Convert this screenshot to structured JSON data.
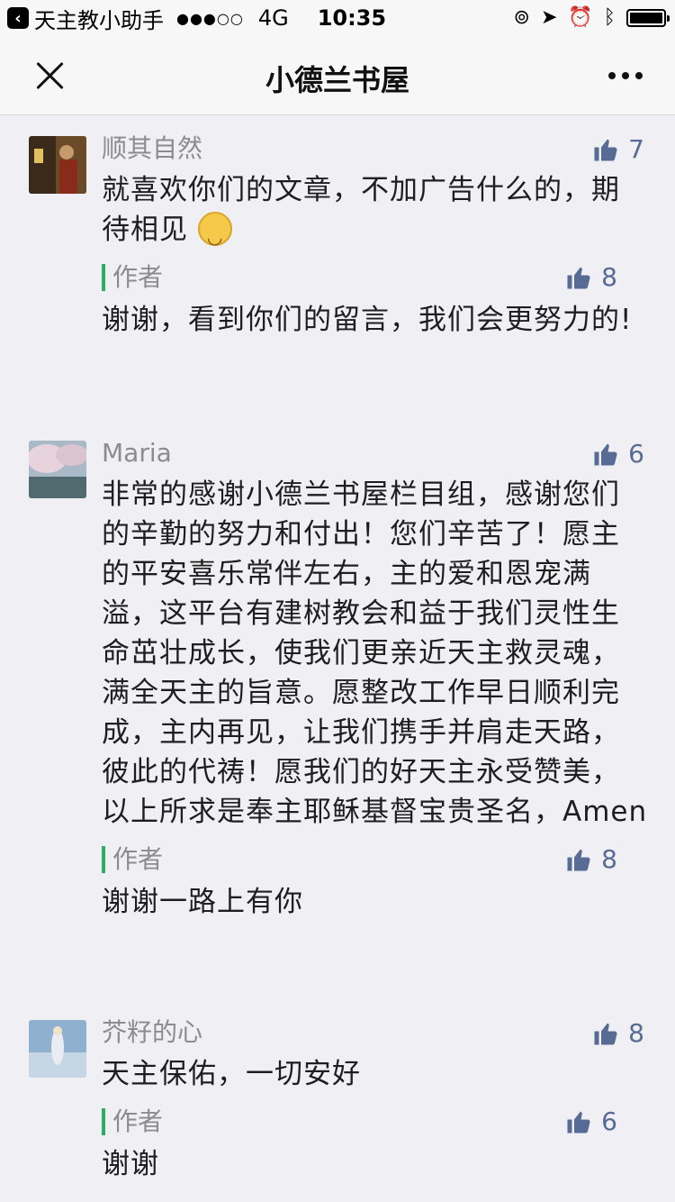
{
  "status": {
    "back_app": "天主教小助手",
    "signal": "●●●○○",
    "network": "4G",
    "time": "10:35"
  },
  "nav": {
    "title": "小德兰书屋"
  },
  "comments": [
    {
      "user": "顺其自然",
      "likes": "7",
      "text": "就喜欢你们的文章，不加广告什么的，期待相见",
      "reply": {
        "label": "作者",
        "likes": "8",
        "text": "谢谢，看到你们的留言，我们会更努力的!"
      }
    },
    {
      "user": "Maria",
      "likes": "6",
      "text": "非常的感谢小德兰书屋栏目组，感谢您们的辛勤的努力和付出！您们辛苦了！愿主的平安喜乐常伴左右，主的爱和恩宠满溢，这平台有建树教会和益于我们灵性生命茁壮成长，使我们更亲近天主救灵魂，满全天主的旨意。愿整改工作早日顺利完成，主内再见，让我们携手并肩走天路，彼此的代祷！愿我们的好天主永受赞美，以上所求是奉主耶稣基督宝贵圣名，Amen",
      "reply": {
        "label": "作者",
        "likes": "8",
        "text": "谢谢一路上有你"
      }
    },
    {
      "user": "芥籽的心",
      "likes": "8",
      "text": "天主保佑，一切安好",
      "reply": {
        "label": "作者",
        "likes": "6",
        "text": "谢谢"
      }
    }
  ],
  "colors": {
    "accent_link": "#576b95",
    "author_bar": "#2aae67"
  }
}
